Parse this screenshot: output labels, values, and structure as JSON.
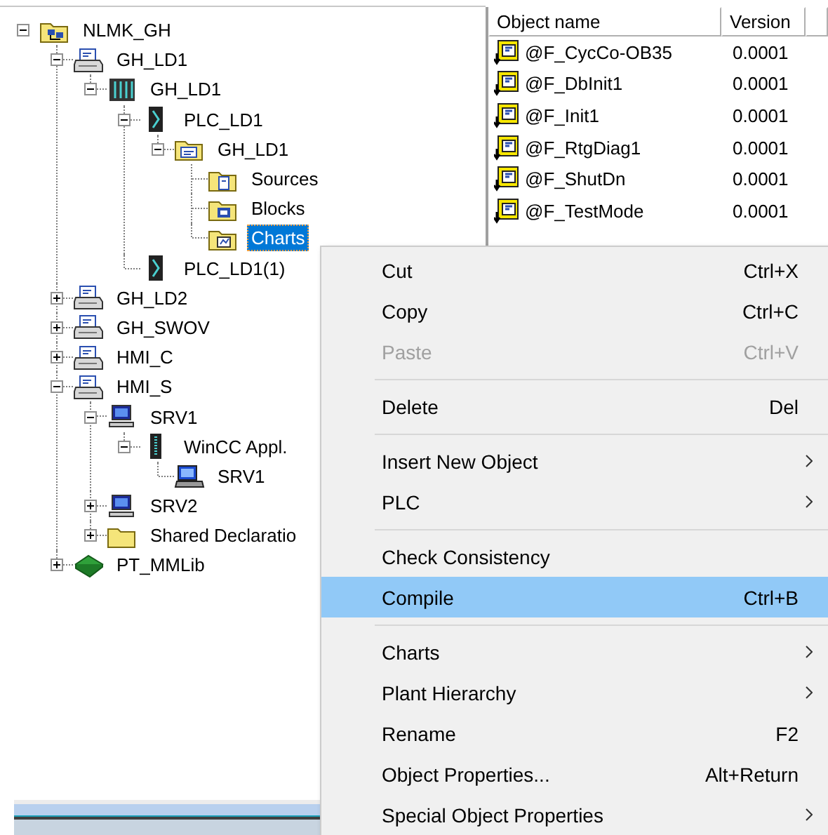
{
  "tree": [
    {
      "label": "NLMK_GH",
      "kind": "project",
      "expanded": true,
      "selected": false,
      "children": [
        {
          "label": "GH_LD1",
          "kind": "station",
          "expanded": true,
          "selected": false,
          "children": [
            {
              "label": "GH_LD1",
              "kind": "rack",
              "expanded": true,
              "selected": false,
              "children": [
                {
                  "label": "PLC_LD1",
                  "kind": "cpu",
                  "expanded": true,
                  "selected": false,
                  "children": [
                    {
                      "label": "GH_LD1",
                      "kind": "program",
                      "expanded": true,
                      "selected": false,
                      "children": [
                        {
                          "label": "Sources",
                          "kind": "sources",
                          "selected": false
                        },
                        {
                          "label": "Blocks",
                          "kind": "blocks",
                          "selected": false
                        },
                        {
                          "label": "Charts",
                          "kind": "charts",
                          "selected": true
                        }
                      ]
                    }
                  ]
                },
                {
                  "label": "PLC_LD1(1)",
                  "kind": "cpu",
                  "selected": false
                }
              ]
            }
          ]
        },
        {
          "label": "GH_LD2",
          "kind": "station",
          "expanded": false,
          "selected": false
        },
        {
          "label": "GH_SWOV",
          "kind": "station",
          "expanded": false,
          "selected": false
        },
        {
          "label": "HMI_C",
          "kind": "station",
          "expanded": false,
          "selected": false
        },
        {
          "label": "HMI_S",
          "kind": "station",
          "expanded": true,
          "selected": false,
          "children": [
            {
              "label": "SRV1",
              "kind": "pc",
              "expanded": true,
              "selected": false,
              "children": [
                {
                  "label": "WinCC Appl.",
                  "kind": "wincc",
                  "expanded": true,
                  "selected": false,
                  "children": [
                    {
                      "label": "SRV1",
                      "kind": "os",
                      "selected": false
                    }
                  ]
                }
              ]
            },
            {
              "label": "SRV2",
              "kind": "pc",
              "expanded": false,
              "selected": false
            },
            {
              "label": "Shared Declaratio",
              "kind": "folder",
              "expanded": false,
              "selected": false
            }
          ]
        },
        {
          "label": "PT_MMLib",
          "kind": "library",
          "expanded": false,
          "selected": false
        }
      ]
    }
  ],
  "object_list": {
    "columns": [
      "Object name",
      "Version"
    ],
    "rows": [
      {
        "name": "@F_CycCo-OB35",
        "version": "0.0001"
      },
      {
        "name": "@F_DbInit1",
        "version": "0.0001"
      },
      {
        "name": "@F_Init1",
        "version": "0.0001"
      },
      {
        "name": "@F_RtgDiag1",
        "version": "0.0001"
      },
      {
        "name": "@F_ShutDn",
        "version": "0.0001"
      },
      {
        "name": "@F_TestMode",
        "version": "0.0001"
      }
    ]
  },
  "context_menu": {
    "items": [
      {
        "kind": "item",
        "label": "Cut",
        "shortcut": "Ctrl+X",
        "disabled": false,
        "submenu": false,
        "selected": false
      },
      {
        "kind": "item",
        "label": "Copy",
        "shortcut": "Ctrl+C",
        "disabled": false,
        "submenu": false,
        "selected": false
      },
      {
        "kind": "item",
        "label": "Paste",
        "shortcut": "Ctrl+V",
        "disabled": true,
        "submenu": false,
        "selected": false
      },
      {
        "kind": "separator"
      },
      {
        "kind": "item",
        "label": "Delete",
        "shortcut": "Del",
        "disabled": false,
        "submenu": false,
        "selected": false
      },
      {
        "kind": "separator"
      },
      {
        "kind": "item",
        "label": "Insert New Object",
        "disabled": false,
        "submenu": true,
        "selected": false
      },
      {
        "kind": "item",
        "label": "PLC",
        "disabled": false,
        "submenu": true,
        "selected": false
      },
      {
        "kind": "separator"
      },
      {
        "kind": "item",
        "label": "Check Consistency",
        "disabled": false,
        "submenu": false,
        "selected": false
      },
      {
        "kind": "item",
        "label": "Compile",
        "shortcut": "Ctrl+B",
        "disabled": false,
        "submenu": false,
        "selected": true
      },
      {
        "kind": "separator"
      },
      {
        "kind": "item",
        "label": "Charts",
        "disabled": false,
        "submenu": true,
        "selected": false
      },
      {
        "kind": "item",
        "label": "Plant Hierarchy",
        "disabled": false,
        "submenu": true,
        "selected": false
      },
      {
        "kind": "item",
        "label": "Rename",
        "shortcut": "F2",
        "disabled": false,
        "submenu": false,
        "selected": false
      },
      {
        "kind": "item",
        "label": "Object Properties...",
        "shortcut": "Alt+Return",
        "disabled": false,
        "submenu": false,
        "selected": false
      },
      {
        "kind": "item",
        "label": "Special Object Properties",
        "disabled": false,
        "submenu": true,
        "selected": false
      }
    ]
  }
}
